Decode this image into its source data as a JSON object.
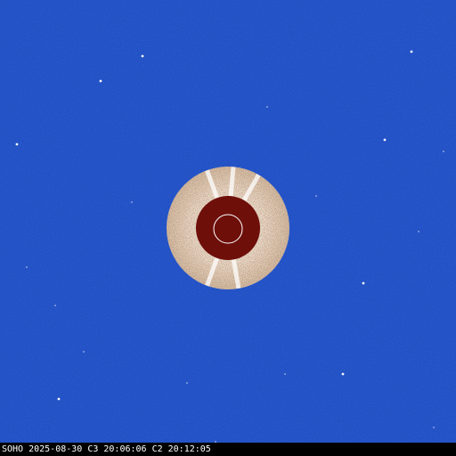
{
  "image": {
    "observatory": "SOHO",
    "date": "2025-08-30",
    "c3_label": "C3",
    "c3_time": "20:06:06",
    "c2_label": "C2",
    "c2_time": "20:12:05",
    "caption": "SOHO 2025-08-30  C3 20:06:06  C2 20:12:05"
  },
  "colors": {
    "background_field": "#1a46c8",
    "c2_corona": "#e8d8c4",
    "occulter_disk": "#6e0f0a",
    "sun_outline": "#ffffff",
    "stars": "#ffffff",
    "caption_bar": "#000000",
    "caption_text": "#ffffff"
  }
}
